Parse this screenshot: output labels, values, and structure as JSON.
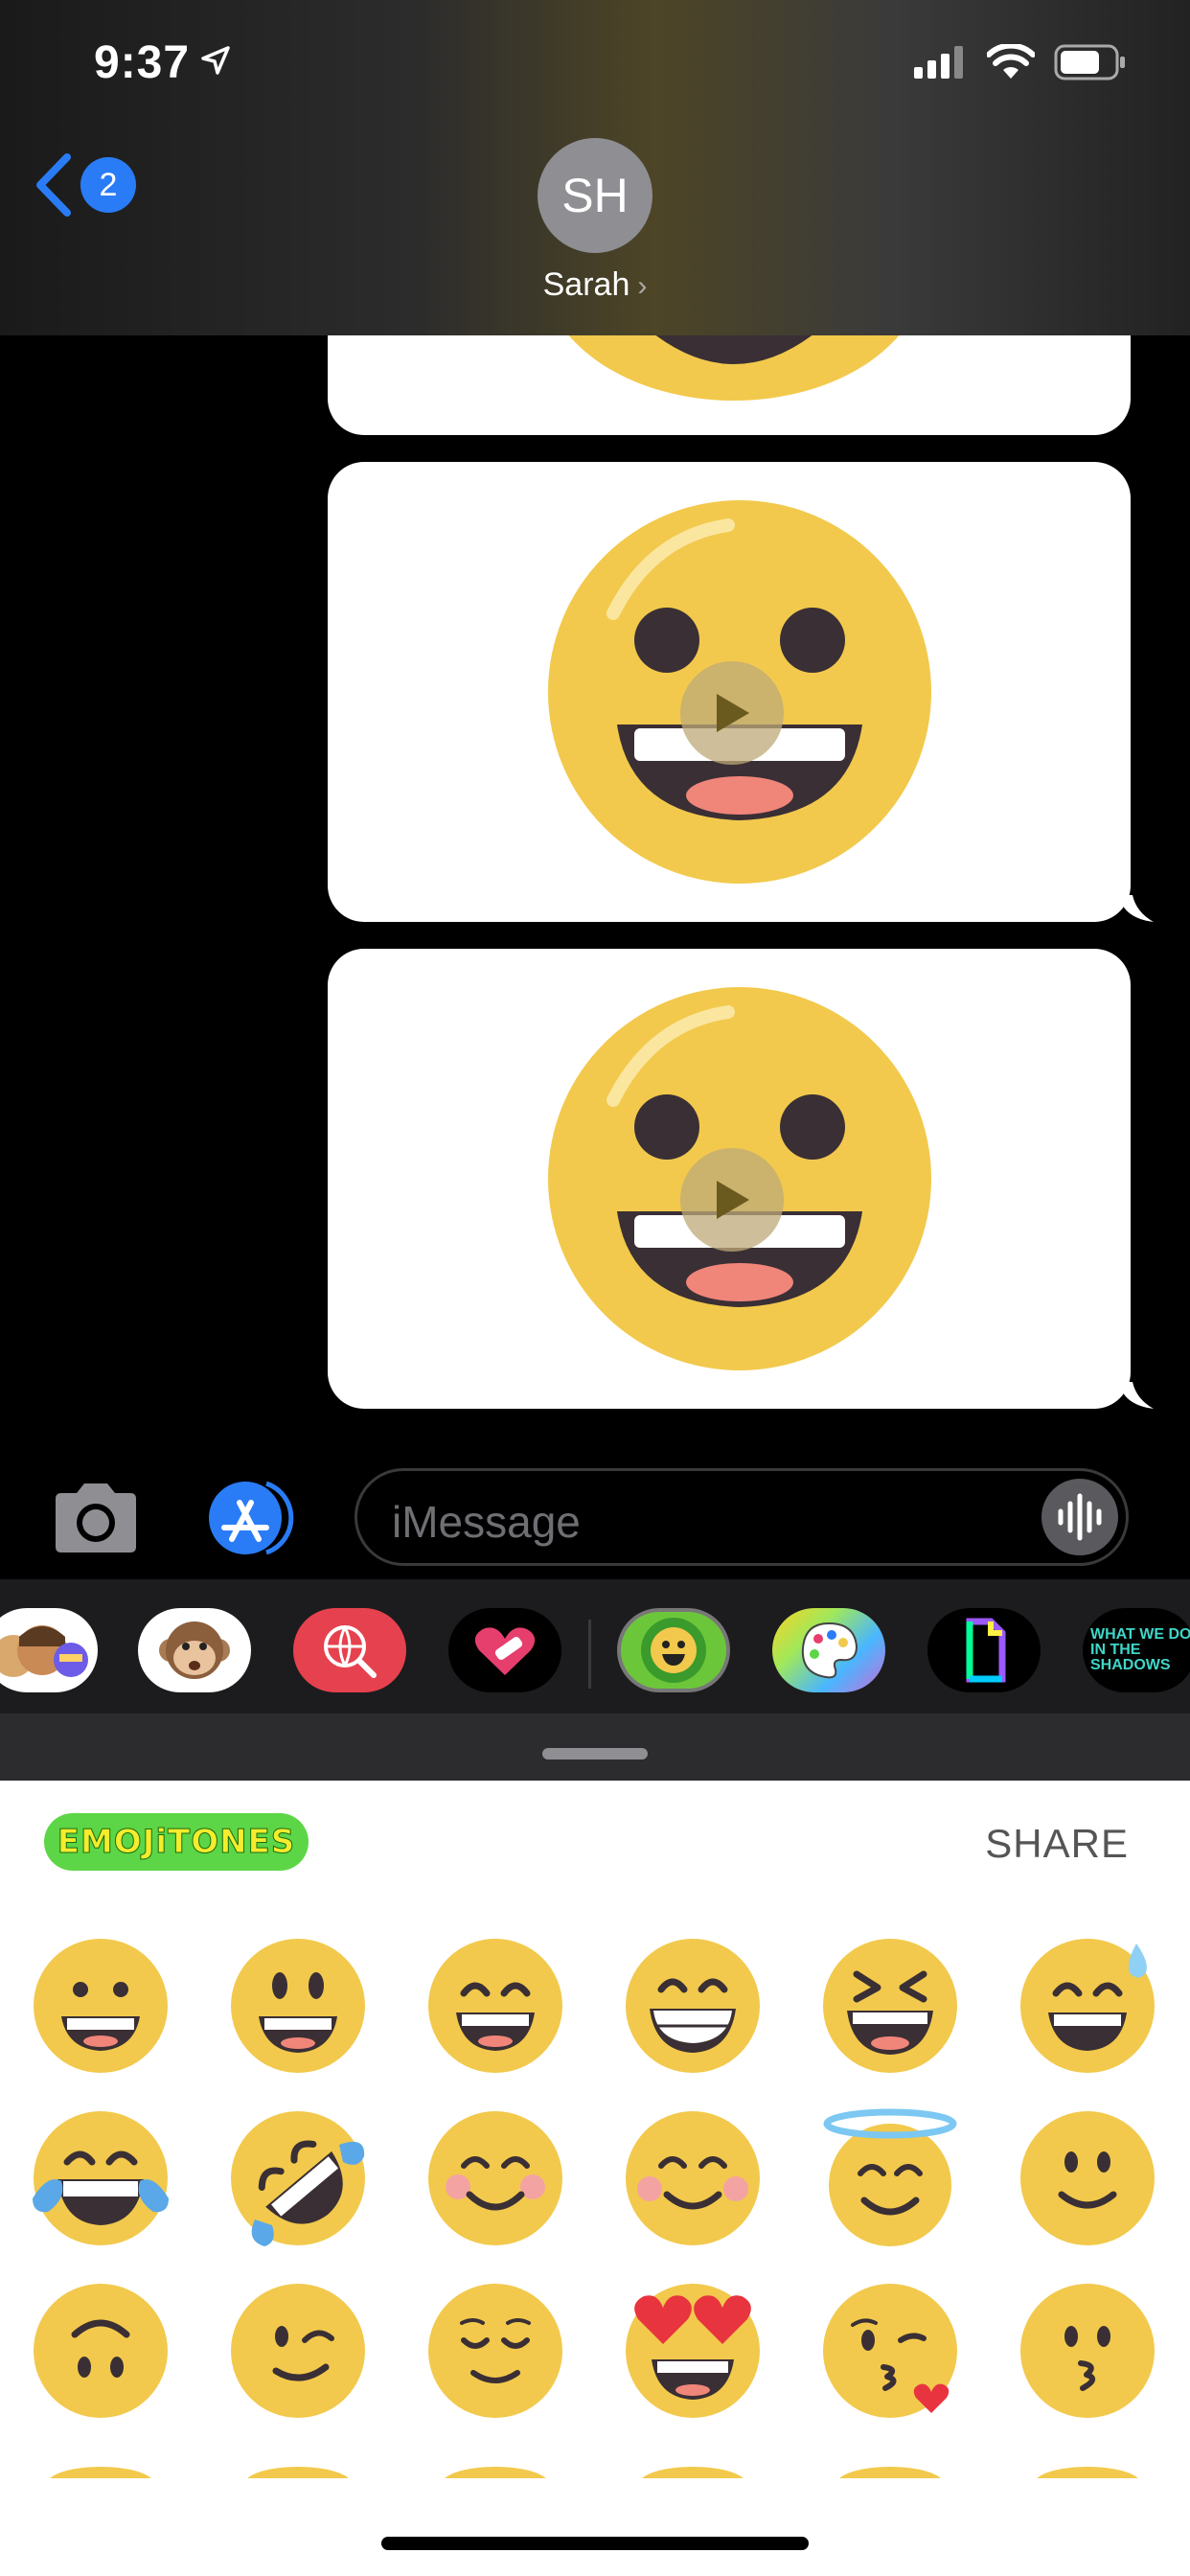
{
  "status_bar": {
    "time": "9:37"
  },
  "nav": {
    "back_count": "2",
    "avatar_initials": "SH",
    "contact_name": "Sarah"
  },
  "composer": {
    "placeholder": "iMessage"
  },
  "app_drawer": {
    "apps": [
      "memoji-stickers",
      "animoji",
      "web-image-search",
      "digital-touch",
      "emojitones",
      "paint",
      "giphy",
      "what-we-do-in-the-shadows"
    ],
    "shadows_label": "WHAT WE DO IN THE SHADOWS"
  },
  "emoji_panel": {
    "brand": "EMOJiTONES",
    "share_label": "SHARE",
    "emojis": [
      "grinning",
      "grinning-big-eyes",
      "grinning-smiling-eyes",
      "beaming",
      "squinting-laughing",
      "sweat-smile",
      "tears-of-joy",
      "rolling-on-floor-laughing",
      "blushing",
      "smiling-eyes",
      "halo",
      "slightly-smiling",
      "upside-down",
      "winking",
      "relieved",
      "heart-eyes",
      "kiss-heart",
      "kissing"
    ]
  },
  "colors": {
    "imessage_blue": "#2a7cf6",
    "emoji_yellow": "#f2c94c",
    "brand_green": "#5cd646"
  }
}
